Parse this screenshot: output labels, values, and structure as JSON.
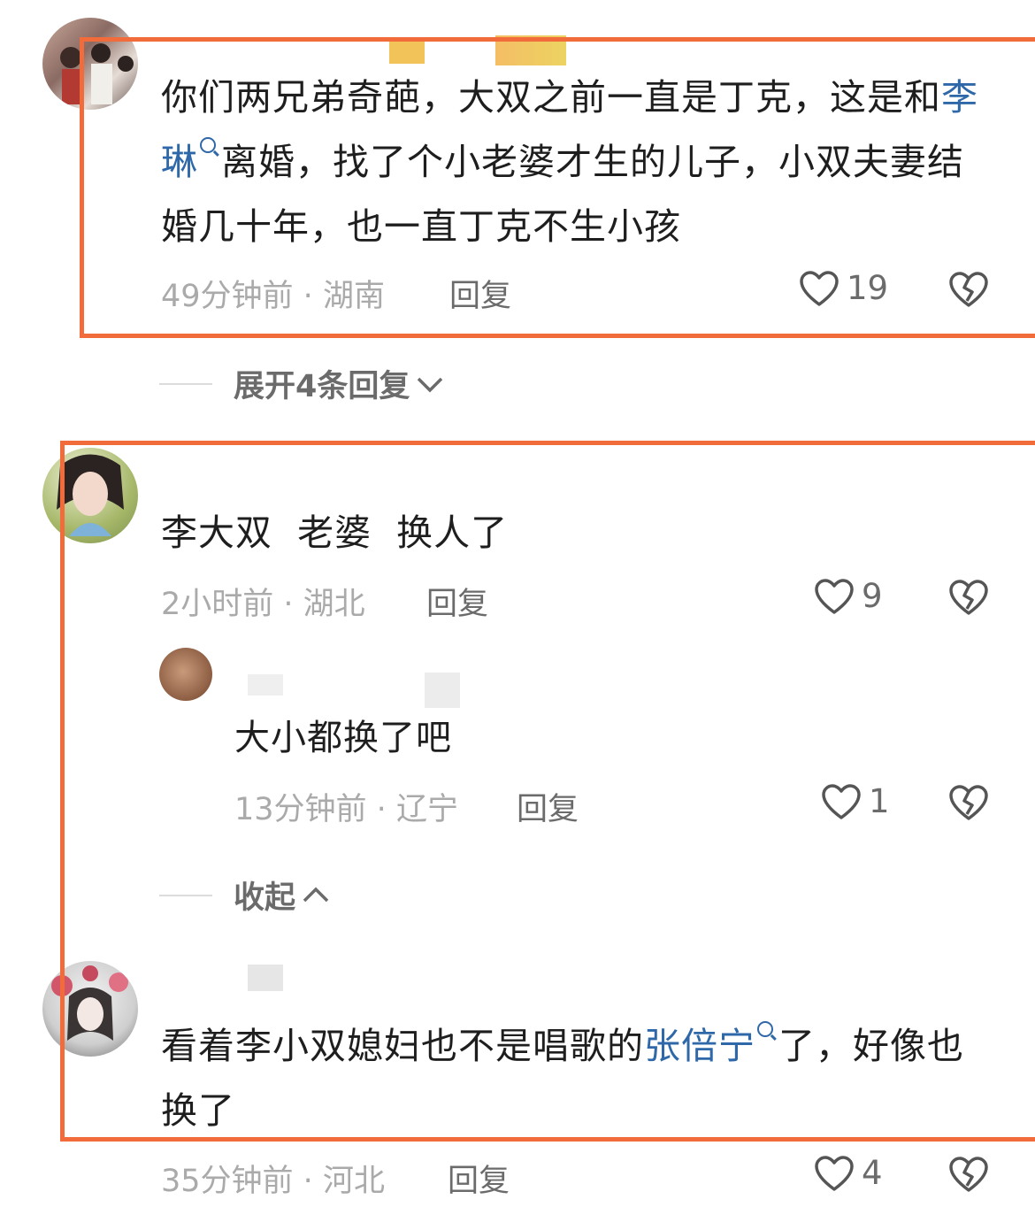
{
  "comments": [
    {
      "text_before_link": "你们两兄弟奇葩，大双之前一直是丁克，这是和",
      "link": "李琳",
      "text_after_link": "离婚，找了个小老婆才生的儿子，小双夫妻结婚几十年，也一直丁克不生小孩",
      "time": "49分钟前",
      "location": "湖南",
      "reply_label": "回复",
      "likes": "19"
    },
    {
      "text": "李大双  老婆  换人了",
      "time": "2小时前",
      "location": "湖北",
      "reply_label": "回复",
      "likes": "9"
    },
    {
      "text_before_link": "看着李小双媳妇也不是唱歌的",
      "link": "张倍宁",
      "text_after_link": "了，好像也换了",
      "time": "35分钟前",
      "location": "河北",
      "reply_label": "回复",
      "likes": "4"
    }
  ],
  "reply": {
    "text": "大小都换了吧",
    "time": "13分钟前",
    "location": "辽宁",
    "reply_label": "回复",
    "likes": "1"
  },
  "expand_replies": "展开4条回复",
  "collapse": "收起",
  "colors": {
    "highlight_box": "#f26b3a",
    "link": "#2f68a8"
  },
  "icons": [
    "heart-icon",
    "broken-heart-icon",
    "search-icon",
    "chevron-down-icon",
    "chevron-up-icon"
  ]
}
